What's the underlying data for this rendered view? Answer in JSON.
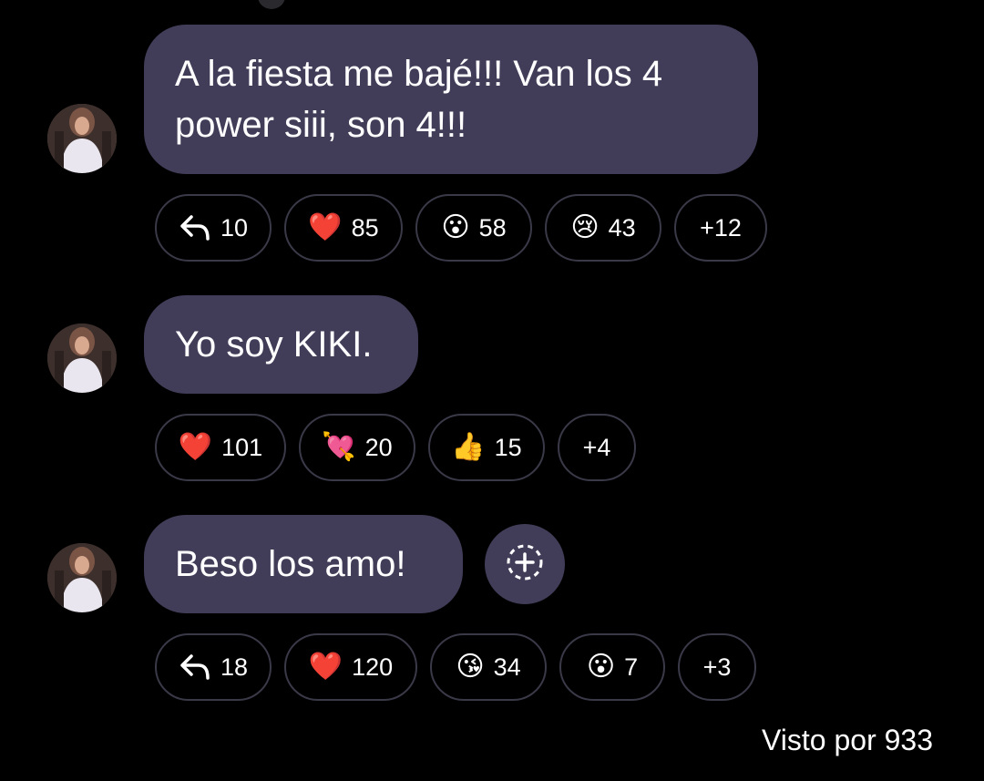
{
  "messages": [
    {
      "text": "A la fiesta me bajé!!! Van los 4\npower siii, son 4!!!",
      "reactions": [
        {
          "icon": "reply-arrow-icon",
          "glyph": "↰",
          "count": "10"
        },
        {
          "icon": "red-heart-icon",
          "glyph": "❤️",
          "count": "85"
        },
        {
          "icon": "surprised-face-icon",
          "glyph": "😮",
          "count": "58"
        },
        {
          "icon": "crying-face-icon",
          "glyph": "😢",
          "count": "43"
        }
      ],
      "more": "+12"
    },
    {
      "text": "Yo soy KIKI.",
      "reactions": [
        {
          "icon": "red-heart-icon",
          "glyph": "❤️",
          "count": "101"
        },
        {
          "icon": "heart-with-arrow-icon",
          "glyph": "💘",
          "count": "20"
        },
        {
          "icon": "thumbs-up-icon",
          "glyph": "👍",
          "count": "15"
        }
      ],
      "more": "+4"
    },
    {
      "text": "Beso los amo!",
      "reactions": [
        {
          "icon": "reply-arrow-icon",
          "glyph": "↰",
          "count": "18"
        },
        {
          "icon": "red-heart-icon",
          "glyph": "❤️",
          "count": "120"
        },
        {
          "icon": "kissing-face-icon",
          "glyph": "😘",
          "count": "34"
        },
        {
          "icon": "surprised-face-icon",
          "glyph": "😮",
          "count": "7"
        }
      ],
      "more": "+3"
    }
  ],
  "add_reaction_icon": "add-reaction-icon",
  "seen_by": "Visto por 933",
  "colors": {
    "background": "#000000",
    "bubble": "#413d58",
    "chip_border": "#3a3948",
    "text": "#ffffff"
  }
}
